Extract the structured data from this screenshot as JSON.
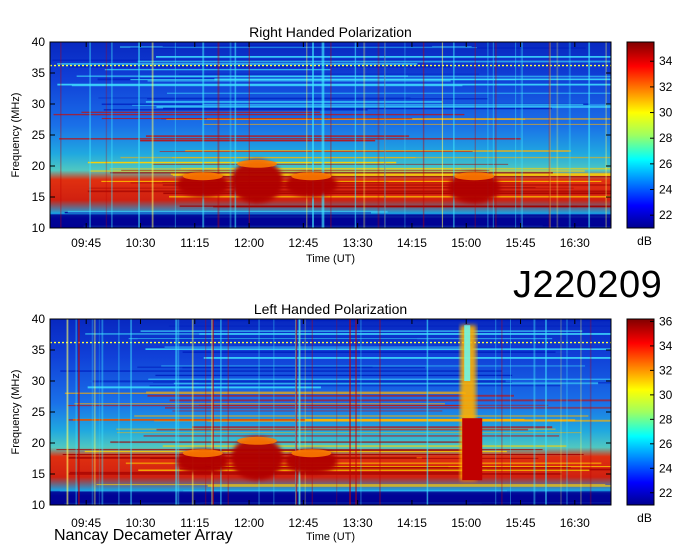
{
  "observation_id": "J220209",
  "footer": "Nancay Decameter Array",
  "chart_data": [
    {
      "type": "heatmap",
      "title": "Right Handed Polarization",
      "xlabel": "Time (UT)",
      "ylabel": "Frequency (MHz)",
      "x_ticks": [
        "09:45",
        "10:30",
        "11:15",
        "12:00",
        "12:45",
        "13:30",
        "14:15",
        "15:00",
        "15:45",
        "16:30"
      ],
      "x_range": [
        "09:15",
        "17:00"
      ],
      "ylim": [
        10,
        40
      ],
      "y_ticks": [
        10,
        15,
        20,
        25,
        30,
        35,
        40
      ],
      "colorbar": {
        "label": "dB",
        "range": [
          21,
          35.5
        ],
        "ticks": [
          22,
          24,
          26,
          28,
          30,
          32,
          34
        ]
      },
      "bursts": [
        {
          "time": "11:15",
          "freq_low": 15,
          "freq_high": 19
        },
        {
          "time": "12:00",
          "freq_low": 14,
          "freq_high": 21
        },
        {
          "time": "12:45",
          "freq_low": 15,
          "freq_high": 19
        },
        {
          "time": "15:00",
          "freq_low": 14,
          "freq_high": 19
        }
      ]
    },
    {
      "type": "heatmap",
      "title": "Left Handed Polarization",
      "xlabel": "Time (UT)",
      "ylabel": "Frequency (MHz)",
      "x_ticks": [
        "09:45",
        "10:30",
        "11:15",
        "12:00",
        "12:45",
        "13:30",
        "14:15",
        "15:00",
        "15:45",
        "16:30"
      ],
      "x_range": [
        "09:15",
        "17:00"
      ],
      "ylim": [
        10,
        40
      ],
      "y_ticks": [
        10,
        15,
        20,
        25,
        30,
        35,
        40
      ],
      "colorbar": {
        "label": "dB",
        "range": [
          21,
          36.2
        ],
        "ticks": [
          22,
          24,
          26,
          28,
          30,
          32,
          34,
          36
        ]
      },
      "bursts": [
        {
          "time": "11:15",
          "freq_low": 15,
          "freq_high": 19
        },
        {
          "time": "12:00",
          "freq_low": 14,
          "freq_high": 21
        },
        {
          "time": "12:45",
          "freq_low": 15,
          "freq_high": 19
        },
        {
          "time": "15:00",
          "freq_low": 14,
          "freq_high": 39
        }
      ]
    }
  ]
}
